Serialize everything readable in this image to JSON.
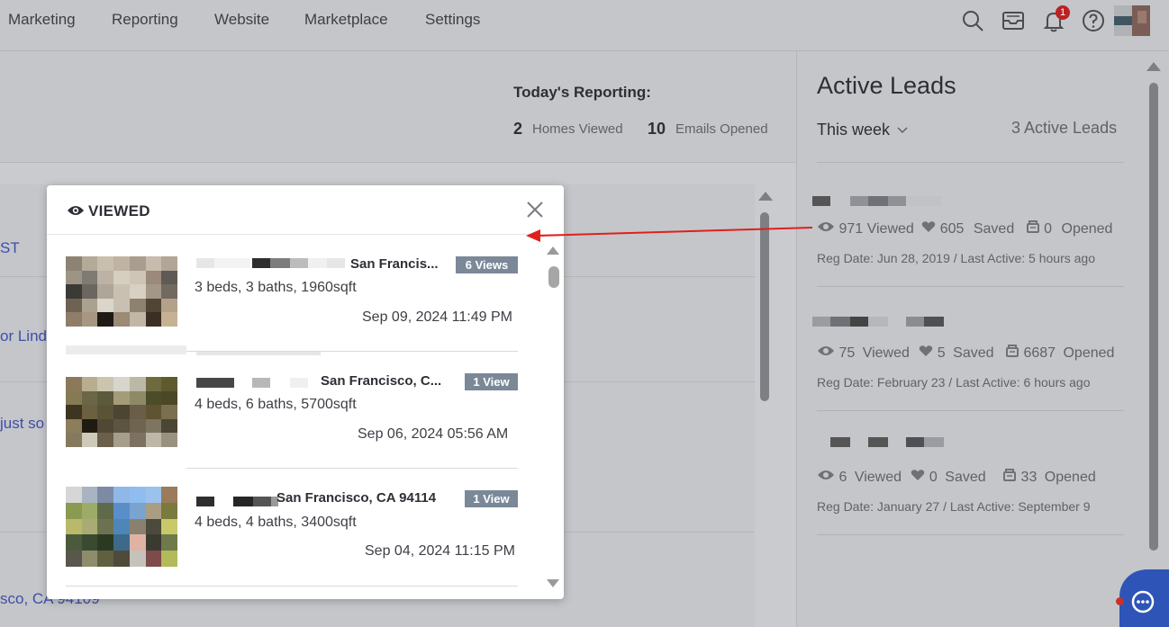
{
  "nav": {
    "items": [
      {
        "label": "Marketing"
      },
      {
        "label": "Reporting"
      },
      {
        "label": "Website"
      },
      {
        "label": "Marketplace"
      },
      {
        "label": "Settings"
      }
    ],
    "notification_count": "1",
    "icons": [
      "search-icon",
      "inbox-icon",
      "bell-icon",
      "help-icon"
    ]
  },
  "reporting": {
    "title": "Today's Reporting:",
    "homes_viewed_count": "2",
    "homes_viewed_label": "Homes Viewed",
    "emails_opened_count": "10",
    "emails_opened_label": "Emails Opened"
  },
  "background_list": {
    "peek_texts": [
      "ST",
      "or Lind",
      "just so",
      "sco, CA 94109"
    ]
  },
  "modal": {
    "title": "VIEWED",
    "properties": [
      {
        "address": "San Francis...",
        "views": "6 Views",
        "specs": "3 beds, 3 baths, 1960sqft",
        "date": "Sep 09, 2024 11:49 PM"
      },
      {
        "address": "San Francisco, C...",
        "views": "1 View",
        "specs": "4 beds, 6 baths, 5700sqft",
        "date": "Sep 06, 2024 05:56 AM"
      },
      {
        "address": "San Francisco, CA 94114",
        "views": "1 View",
        "specs": "4 beds, 4 baths, 3400sqft",
        "date": "Sep 04, 2024 11:15 PM"
      }
    ]
  },
  "active_leads": {
    "title": "Active Leads",
    "period": "This week",
    "count_label": "3 Active Leads",
    "leads": [
      {
        "viewed": "971",
        "viewed_label": "Viewed",
        "saved": "605",
        "saved_label": "Saved",
        "opened": "0",
        "opened_label": "Opened",
        "reg": "Reg Date: Jun 28, 2019 / Last Active: 5 hours ago"
      },
      {
        "viewed": "75",
        "viewed_label": "Viewed",
        "saved": "5",
        "saved_label": "Saved",
        "opened": "6687",
        "opened_label": "Opened",
        "reg": "Reg Date: February 23 / Last Active: 6 hours ago"
      },
      {
        "viewed": "6",
        "viewed_label": "Viewed",
        "saved": "0",
        "saved_label": "Saved",
        "opened": "33",
        "opened_label": "Opened",
        "reg": "Reg Date: January 27 / Last Active: September 9"
      }
    ]
  },
  "colors": {
    "accent": "#2f54b8",
    "badge": "#7a8898",
    "arrow": "#e0201c",
    "notification": "#b22222"
  }
}
